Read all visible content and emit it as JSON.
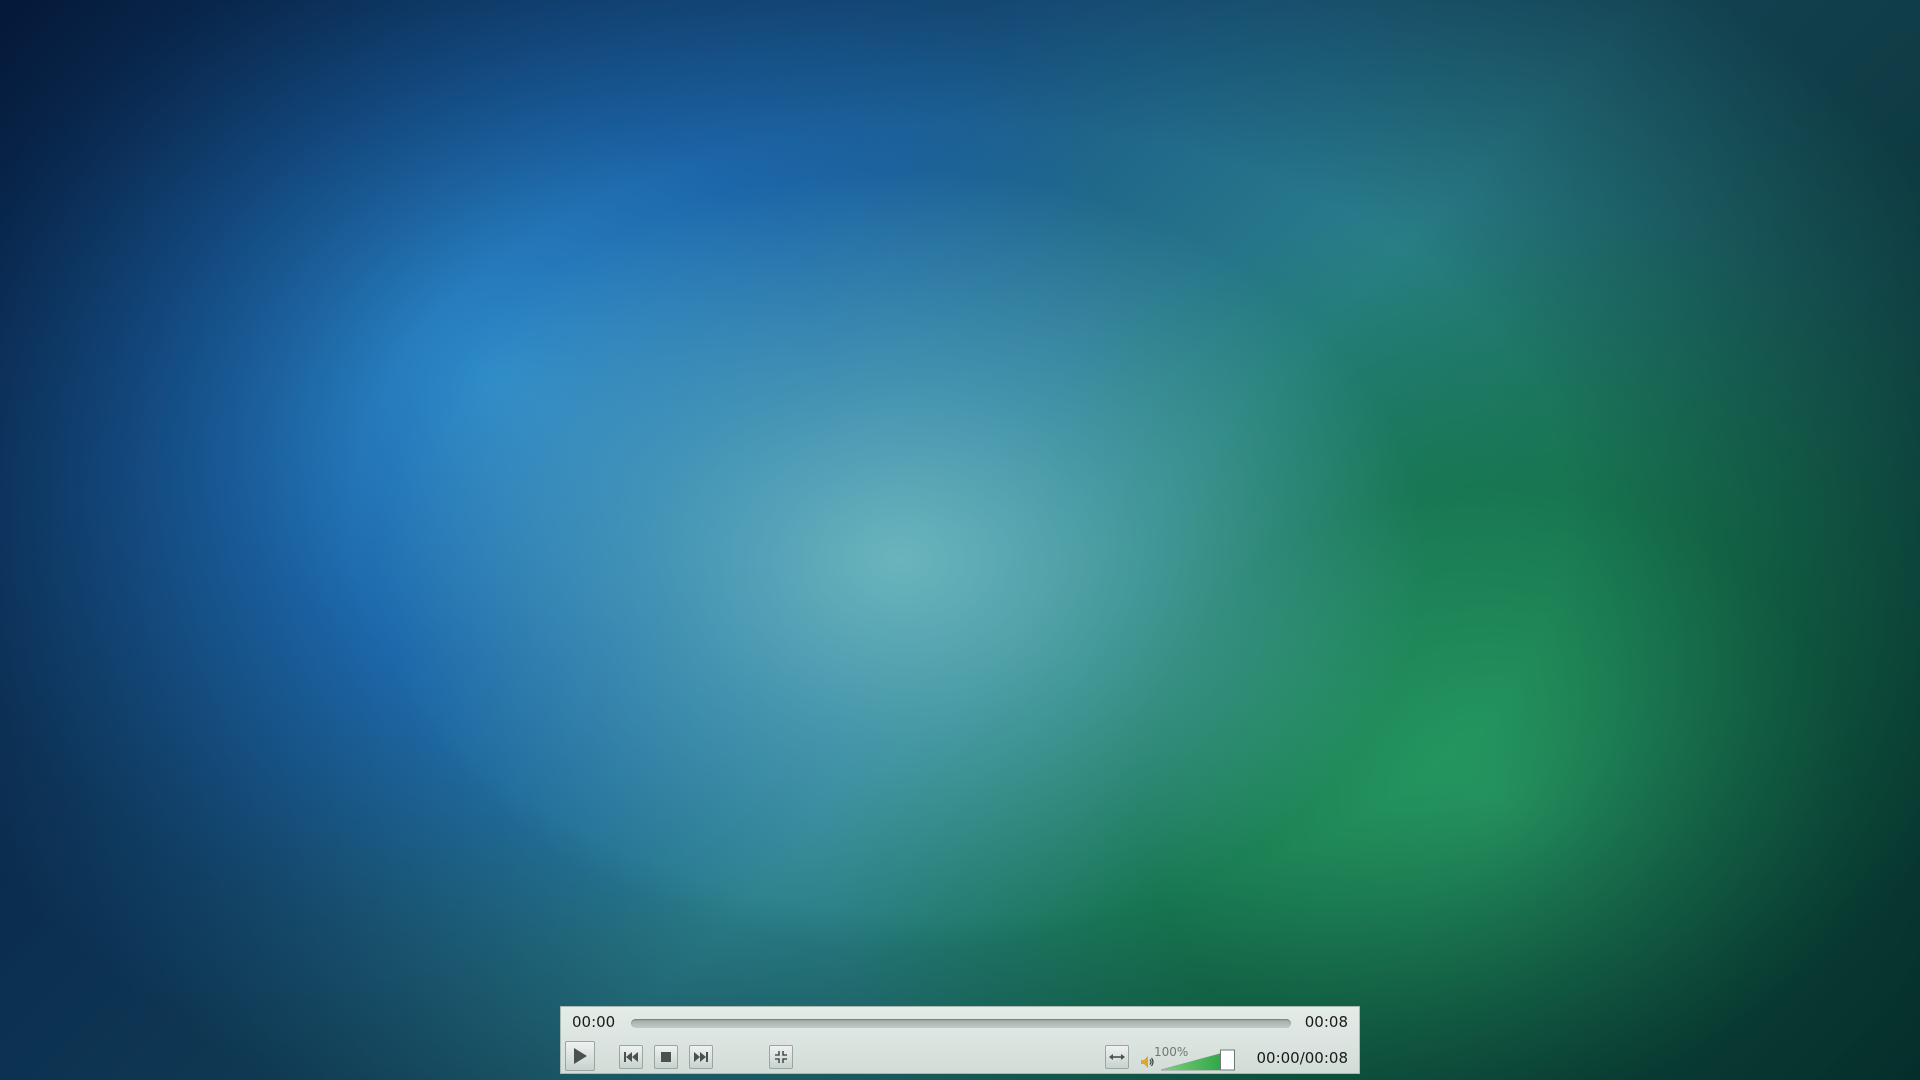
{
  "player": {
    "elapsed": "00:00",
    "total": "00:08",
    "readout": "00:00/00:08",
    "progress": 0,
    "volume_label": "100%",
    "volume_level": 1.0,
    "accent_color": "#2fb34a"
  },
  "controls": {
    "play": "play-icon",
    "previous": "skip-previous-icon",
    "stop": "stop-icon",
    "next": "skip-next-icon",
    "fullscreen": "fullscreen-icon",
    "stretch": "stretch-horizontal-icon",
    "volume": "speaker-icon"
  }
}
